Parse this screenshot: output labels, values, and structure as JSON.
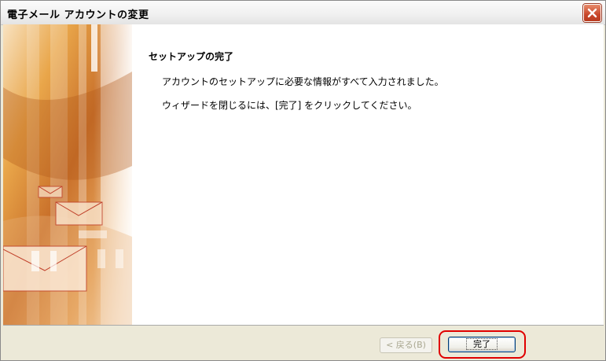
{
  "window": {
    "title": "電子メール アカウントの変更",
    "close_icon": "close-icon"
  },
  "sidebar_art": {
    "description_icon": "envelope-art",
    "colors": [
      "#c5651c",
      "#e8a33c",
      "#f6d39a",
      "#ffffff"
    ]
  },
  "content": {
    "heading": "セットアップの完了",
    "line1": "アカウントのセットアップに必要な情報がすべて入力されました。",
    "line2": "ウィザードを閉じるには、[完了] をクリックしてください。"
  },
  "buttons": {
    "back_label": "< 戻る(B)",
    "back_enabled": false,
    "finish_label": "完了",
    "highlight_color": "#e00000"
  }
}
